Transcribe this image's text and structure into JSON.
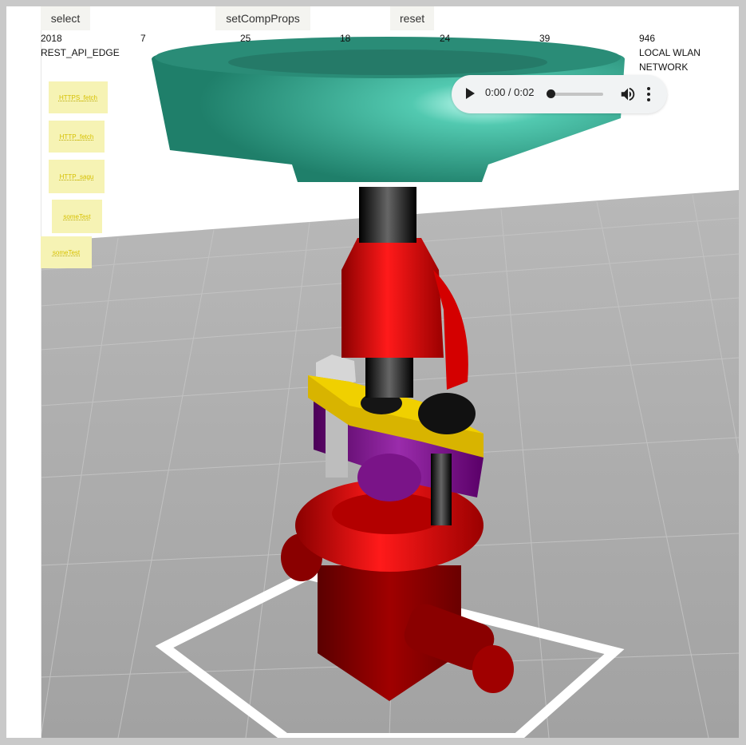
{
  "toolbar": {
    "select_label": "select",
    "setcompprops_label": "setCompProps",
    "reset_label": "reset"
  },
  "stats": {
    "values": [
      "2018",
      "7",
      "25",
      "18",
      "24",
      "39",
      "946"
    ],
    "left_label": "REST_API_EDGE",
    "right_label_line1": "LOCAL WLAN",
    "right_label_line2": "NETWORK"
  },
  "chips": [
    "HTTPS_fetch",
    "HTTP_fetch",
    "HTTP_sagu",
    "someTest",
    "someTest"
  ],
  "audio": {
    "time": "0:00 / 0:02",
    "play_icon": "play-icon",
    "volume_icon": "volume-icon",
    "menu_icon": "more-vert-icon"
  },
  "colors": {
    "bowl_teal": "#2e9a82",
    "body_red": "#cc0000",
    "ring_yellow": "#d8b400",
    "ring_purple": "#6a0a7a",
    "base_darkred": "#7a0000",
    "floor_gray": "#a9a9a9",
    "chip_bg": "#f6f3b4",
    "chip_text": "#d6c000"
  }
}
